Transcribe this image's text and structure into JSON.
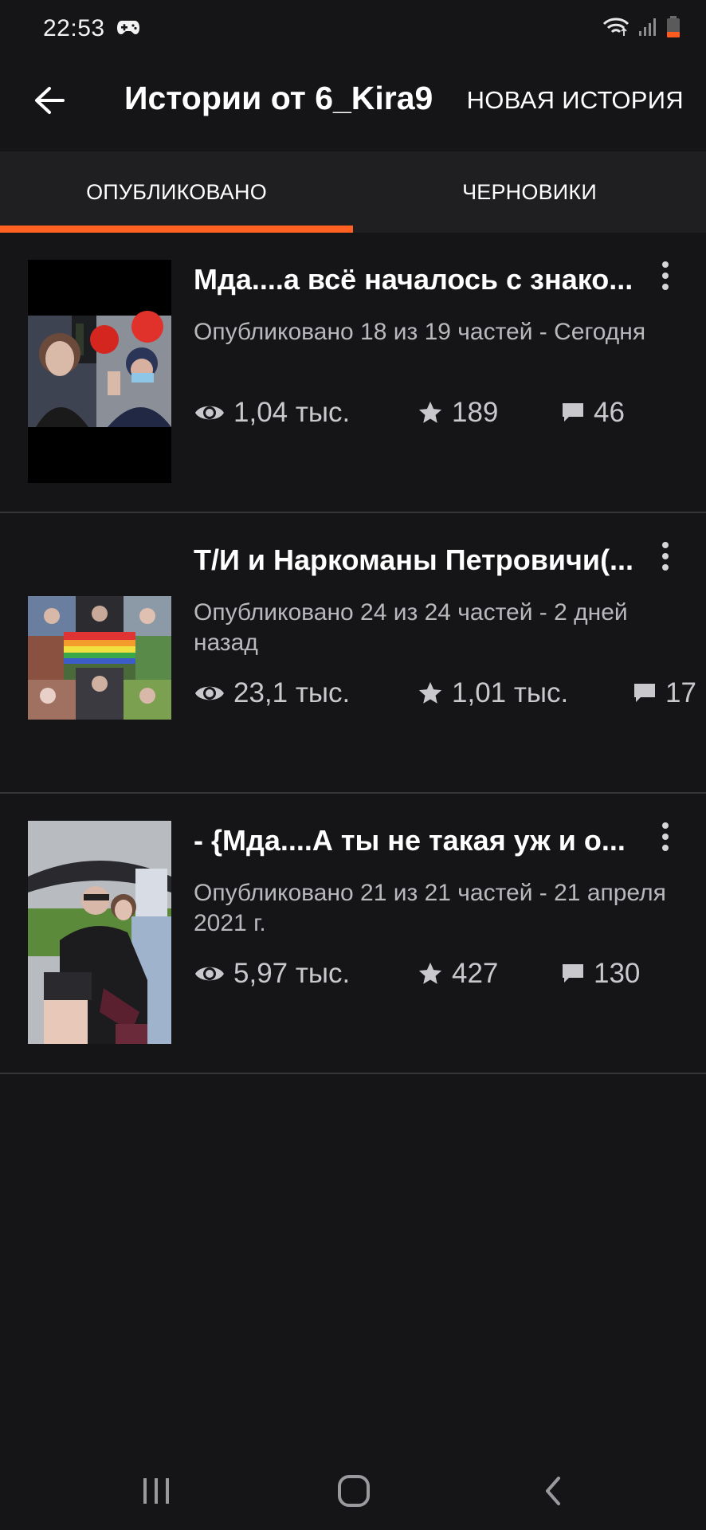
{
  "status_bar": {
    "time": "22:53",
    "icons": [
      "gamepad-icon",
      "wifi-icon",
      "signal-icon",
      "battery-icon"
    ]
  },
  "app_bar": {
    "title": "Истории от 6_Kira9",
    "new_story_label": "НОВАЯ ИСТОРИЯ"
  },
  "tabs": [
    {
      "label": "ОПУБЛИКОВАНО",
      "active": true
    },
    {
      "label": "ЧЕРНОВИКИ",
      "active": false
    }
  ],
  "stories": [
    {
      "title": "Мда....а всё началось с знако...",
      "meta": "Опубликовано 18 из 19 частей - Сегодня",
      "views": "1,04 тыс.",
      "votes": "189",
      "comments": "46"
    },
    {
      "title": "Т/И и Наркоманы Петровичи(...",
      "meta": "Опубликовано 24 из 24 частей - 2 дней назад",
      "views": "23,1 тыс.",
      "votes": "1,01 тыс.",
      "comments": "17"
    },
    {
      "title": "- {Мда....А ты не такая уж и о...",
      "meta": "Опубликовано 21 из 21 частей - 21 апреля 2021 г.",
      "views": "5,97 тыс.",
      "votes": "427",
      "comments": "130"
    }
  ],
  "colors": {
    "background": "#151417",
    "tab_bar": "#1f1e21",
    "accent": "#ff6122",
    "divider": "#36353a",
    "secondary_text": "#b9b8bd"
  }
}
